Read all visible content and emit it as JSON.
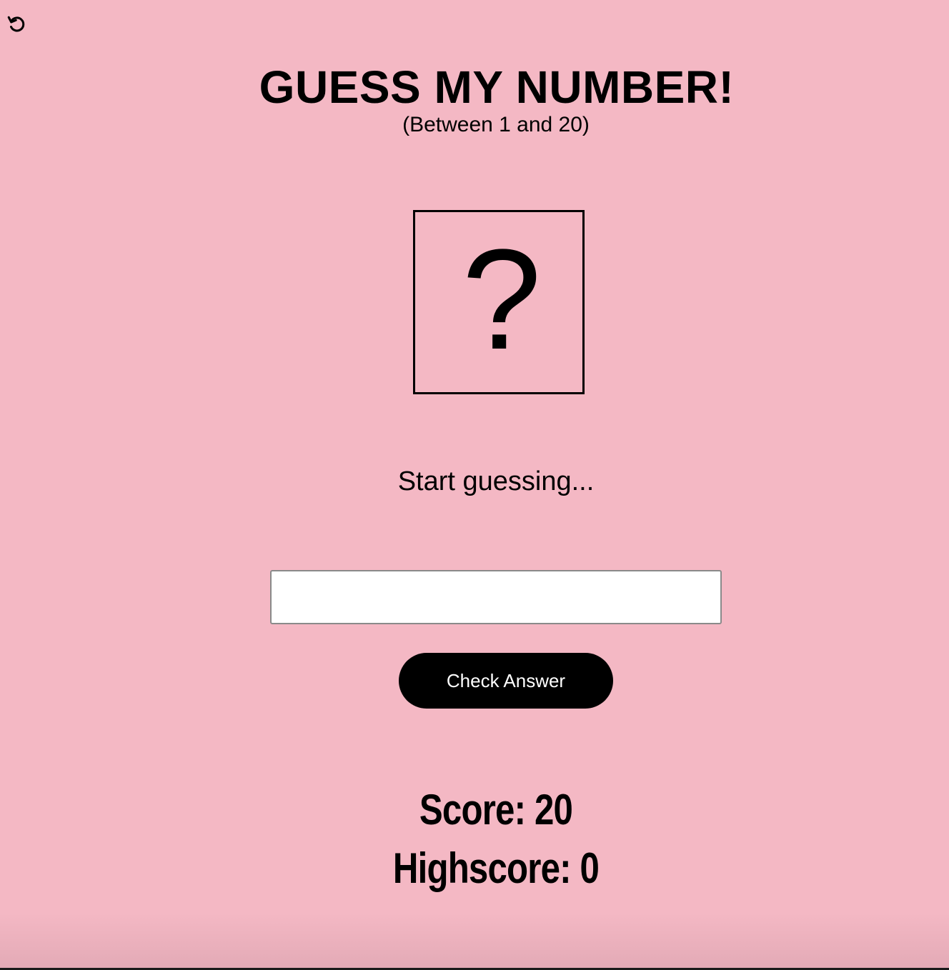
{
  "header": {
    "reset_icon": "reset-icon",
    "title": "GUESS MY NUMBER!",
    "subtitle": "(Between 1 and 20)"
  },
  "secret": {
    "display": "?"
  },
  "message": "Start guessing...",
  "guess_input": {
    "value": "",
    "placeholder": ""
  },
  "check_button_label": "Check Answer",
  "score": {
    "text": "Score: 20",
    "value": 20
  },
  "highscore": {
    "text": "Highscore: 0",
    "value": 0
  },
  "colors": {
    "background": "#f4b8c4",
    "button": "#000000",
    "button_text": "#ffffff"
  }
}
